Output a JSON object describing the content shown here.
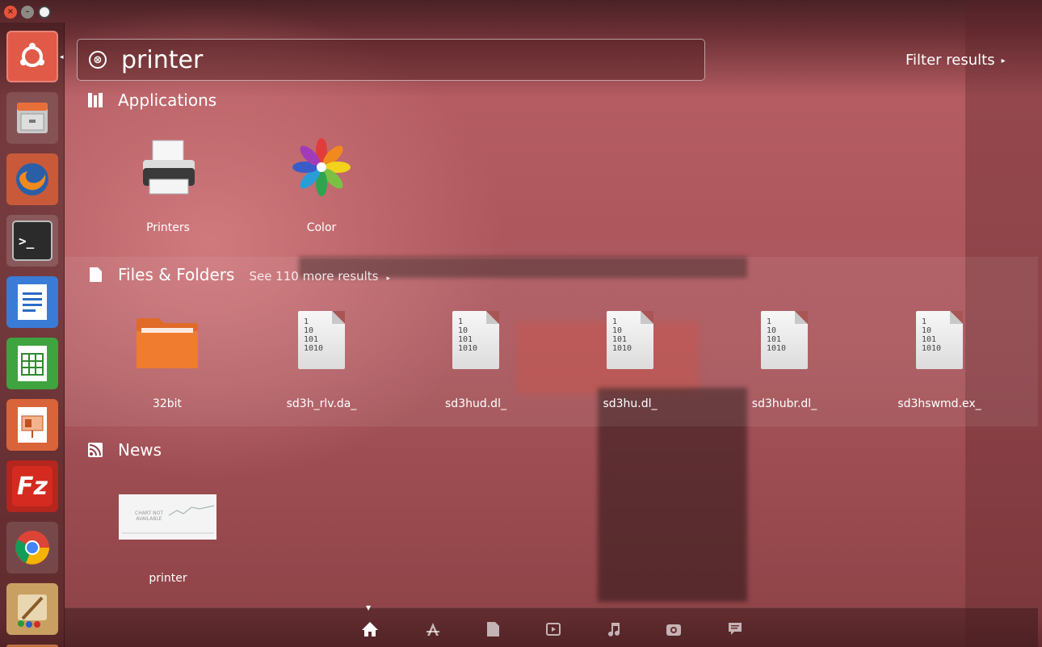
{
  "window_controls": {
    "close": "×",
    "minimize": "–",
    "maximize": "□"
  },
  "launcher": {
    "items": [
      {
        "name": "ubuntu-dash-icon"
      },
      {
        "name": "files-icon"
      },
      {
        "name": "firefox-icon"
      },
      {
        "name": "terminal-icon",
        "glyph": ">_"
      },
      {
        "name": "libreoffice-writer-icon"
      },
      {
        "name": "libreoffice-calc-icon"
      },
      {
        "name": "libreoffice-impress-icon"
      },
      {
        "name": "filezilla-icon",
        "glyph": "Fz"
      },
      {
        "name": "chrome-icon"
      },
      {
        "name": "paint-icon"
      }
    ]
  },
  "search": {
    "value": "printer",
    "clear_icon": "⊗"
  },
  "filter": {
    "label": "Filter results",
    "arrow": "▸"
  },
  "categories": {
    "applications": {
      "title": "Applications",
      "items": [
        {
          "label": "Printers"
        },
        {
          "label": "Color"
        }
      ]
    },
    "files": {
      "title": "Files & Folders",
      "more": "See 110 more results",
      "more_arrow": "▸",
      "items": [
        {
          "label": "32bit",
          "kind": "folder"
        },
        {
          "label": "sd3h_rlv.da_",
          "kind": "binary"
        },
        {
          "label": "sd3hud.dl_",
          "kind": "binary"
        },
        {
          "label": "sd3hu.dl_",
          "kind": "binary"
        },
        {
          "label": "sd3hubr.dl_",
          "kind": "binary"
        },
        {
          "label": "sd3hswmd.ex_",
          "kind": "binary"
        }
      ],
      "binary_text": "1\n10\n101\n1010"
    },
    "news": {
      "title": "News",
      "items": [
        {
          "label": "printer",
          "thumb_text_1": "CHART NOT",
          "thumb_text_2": "AVAILABLE"
        }
      ]
    }
  },
  "lens_bar": {
    "items": [
      "home-lens-icon",
      "applications-lens-icon",
      "files-lens-icon",
      "video-lens-icon",
      "music-lens-icon",
      "photo-lens-icon",
      "social-lens-icon"
    ],
    "active": "home-lens-icon"
  }
}
